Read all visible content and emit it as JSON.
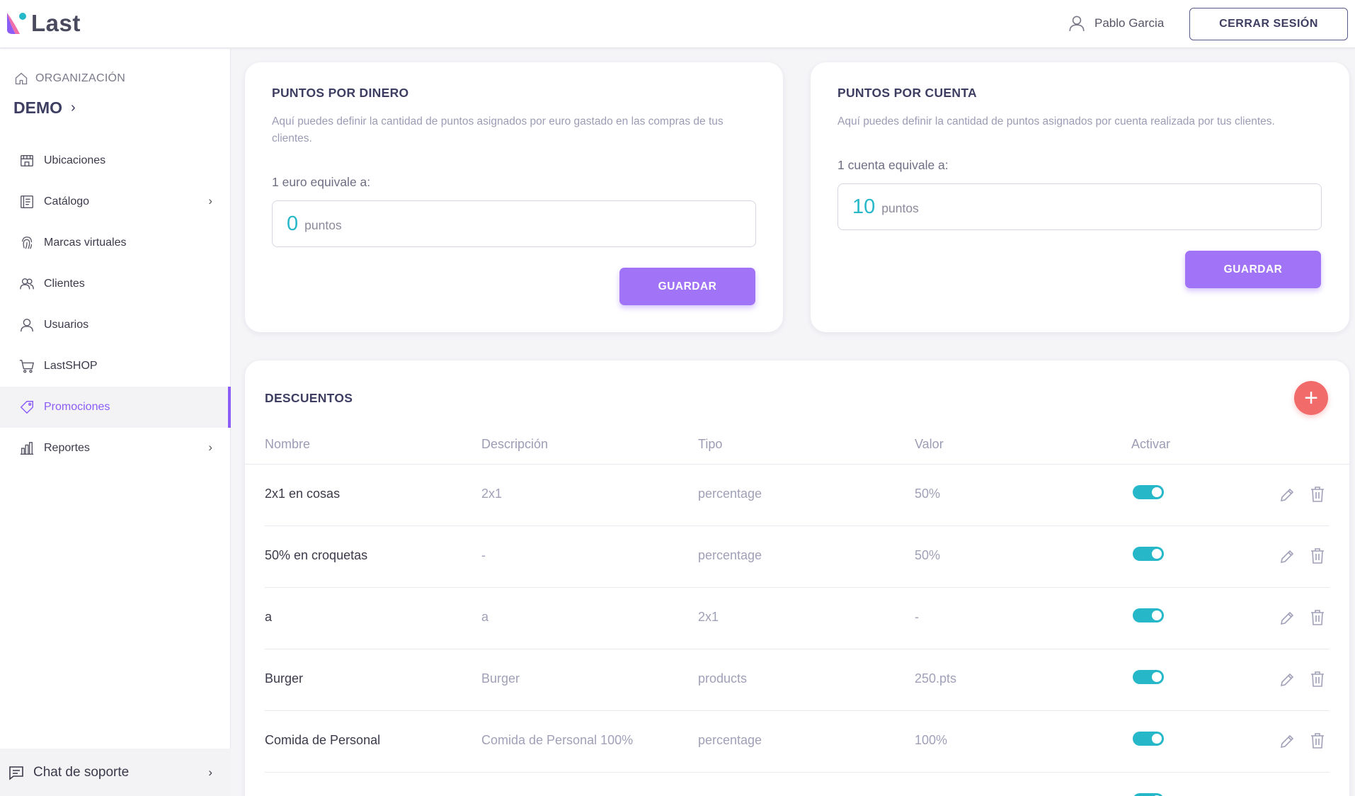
{
  "header": {
    "logo_text": "Last",
    "user_name": "Pablo Garcia",
    "logout_label": "CERRAR SESIÓN"
  },
  "sidebar": {
    "org_label": "ORGANIZACIÓN",
    "org_name": "DEMO",
    "items": [
      {
        "label": "Ubicaciones",
        "icon": "store-icon",
        "chevron": false,
        "active": false
      },
      {
        "label": "Catálogo",
        "icon": "catalog-icon",
        "chevron": true,
        "active": false
      },
      {
        "label": "Marcas virtuales",
        "icon": "fingerprint-icon",
        "chevron": false,
        "active": false
      },
      {
        "label": "Clientes",
        "icon": "users-icon",
        "chevron": false,
        "active": false
      },
      {
        "label": "Usuarios",
        "icon": "user-icon",
        "chevron": false,
        "active": false
      },
      {
        "label": "LastSHOP",
        "icon": "cart-icon",
        "chevron": false,
        "active": false
      },
      {
        "label": "Promociones",
        "icon": "tag-icon",
        "chevron": false,
        "active": true
      },
      {
        "label": "Reportes",
        "icon": "bar-chart-icon",
        "chevron": true,
        "active": false
      }
    ],
    "support_label": "Chat de soporte"
  },
  "money_card": {
    "title": "PUNTOS POR DINERO",
    "description": "Aquí puedes definir la cantidad de puntos asignados por euro gastado en las compras de tus clientes.",
    "label": "1 euro equivale a:",
    "value": "0",
    "unit": "puntos",
    "save_label": "GUARDAR"
  },
  "account_card": {
    "title": "PUNTOS POR CUENTA",
    "description": "Aquí puedes definir la cantidad de puntos asignados por cuenta realizada por tus clientes.",
    "label": "1 cuenta equivale a:",
    "value": "10",
    "unit": "puntos",
    "save_label": "GUARDAR"
  },
  "discounts": {
    "title": "DESCUENTOS",
    "columns": [
      "Nombre",
      "Descripción",
      "Tipo",
      "Valor",
      "Activar"
    ],
    "rows": [
      {
        "nombre": "2x1 en cosas",
        "descripcion": "2x1",
        "tipo": "percentage",
        "valor": "50%",
        "activo": true
      },
      {
        "nombre": "50% en croquetas",
        "descripcion": "-",
        "tipo": "percentage",
        "valor": "50%",
        "activo": true
      },
      {
        "nombre": "a",
        "descripcion": "a",
        "tipo": "2x1",
        "valor": "-",
        "activo": true
      },
      {
        "nombre": "Burger",
        "descripcion": "Burger",
        "tipo": "products",
        "valor": "250.pts",
        "activo": true
      },
      {
        "nombre": "Comida de Personal",
        "descripcion": "Comida de Personal 100%",
        "tipo": "percentage",
        "valor": "100%",
        "activo": true
      }
    ]
  },
  "colors": {
    "accent": "#a173f7",
    "toggle_on": "#26b8c9",
    "add_button": "#f26b6b"
  }
}
